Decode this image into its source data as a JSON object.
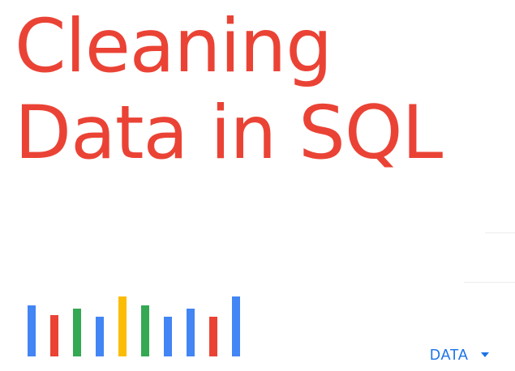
{
  "title": {
    "line1": "Cleaning",
    "line2": "Data in SQL",
    "color": "#ea4335"
  },
  "logo": {
    "icon": "bar-chart-logo-icon",
    "bar_colors": [
      "#4285f4",
      "#ea4335",
      "#34a853",
      "#4285f4",
      "#fbbc04",
      "#34a853",
      "#4285f4",
      "#4285f4",
      "#ea4335",
      "#4285f4"
    ],
    "bar_levels": [
      0.83,
      0.67,
      0.77,
      0.65,
      0.97,
      0.83,
      0.65,
      0.77,
      0.65,
      0.97
    ]
  },
  "data_menu": {
    "label": "DATA",
    "icon": "chevron-down-icon",
    "color": "#1a73e8"
  }
}
